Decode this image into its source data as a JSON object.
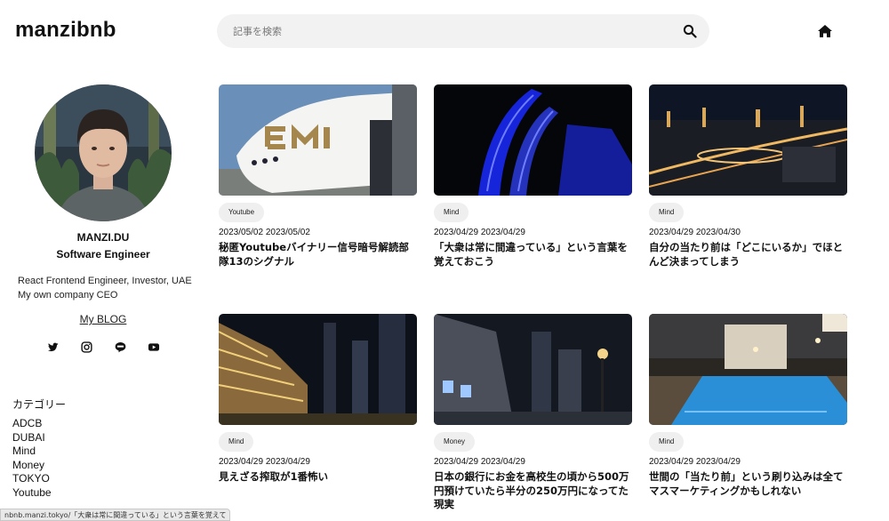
{
  "header": {
    "logo": "manzibnb",
    "search_placeholder": "記事を検索"
  },
  "profile": {
    "name": "MANZI.DU",
    "role": "Software Engineer",
    "bio": "React Frontend Engineer, Investor, UAE My own company CEO",
    "blog_link": "My BLOG"
  },
  "categories": {
    "title": "カテゴリー",
    "items": [
      "ADCB",
      "DUBAI",
      "Mind",
      "Money",
      "TOKYO",
      "Youtube"
    ]
  },
  "posts": [
    {
      "tag": "Youtube",
      "dates": "2023/05/02 2023/05/02",
      "title": "秘匿Youtubeバイナリー信号暗号解読部隊13のシグナル"
    },
    {
      "tag": "Mind",
      "dates": "2023/04/29 2023/04/29",
      "title": "「大衆は常に間違っている」という言葉を覚えておこう"
    },
    {
      "tag": "Mind",
      "dates": "2023/04/29 2023/04/30",
      "title": "自分の当たり前は「どこにいるか」でほとんど決まってしまう"
    },
    {
      "tag": "Mind",
      "dates": "2023/04/29 2023/04/29",
      "title": "見えざる搾取が1番怖い"
    },
    {
      "tag": "Money",
      "dates": "2023/04/29 2023/04/29",
      "title": "日本の銀行にお金を高校生の頃から500万円預けていたら半分の250万円になってた現実"
    },
    {
      "tag": "Mind",
      "dates": "2023/04/29 2023/04/29",
      "title": "世間の「当たり前」という刷り込みは全てマスマーケティングかもしれない"
    }
  ],
  "status_bar": "nbnb.manzi.tokyo/「大衆は常に間違っている」という言葉を覚えて"
}
